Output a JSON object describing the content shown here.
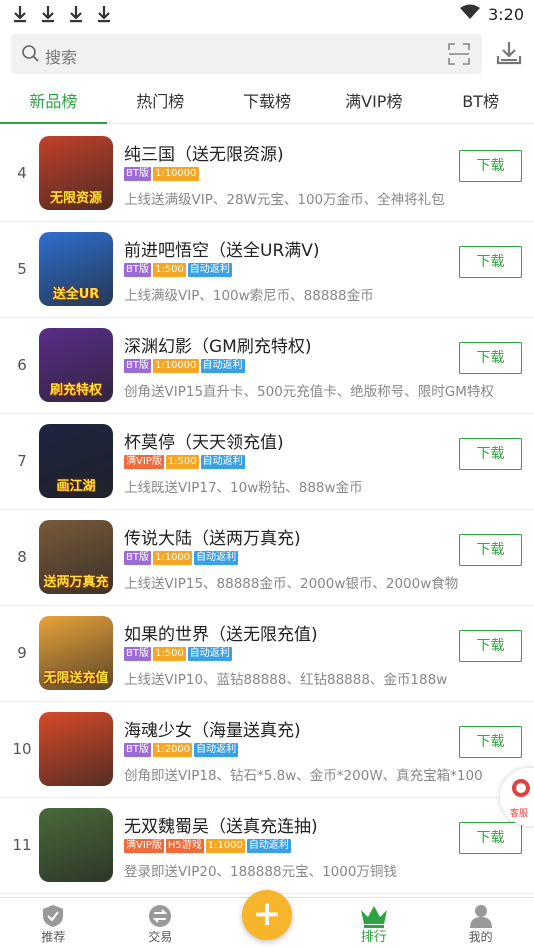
{
  "status_bar": {
    "time": "3:20"
  },
  "search": {
    "placeholder": "搜索"
  },
  "tabs": [
    {
      "label": "新品榜",
      "active": true
    },
    {
      "label": "热门榜",
      "active": false
    },
    {
      "label": "下载榜",
      "active": false
    },
    {
      "label": "满VIP榜",
      "active": false
    },
    {
      "label": "BT榜",
      "active": false
    }
  ],
  "colors": {
    "accent": "#2ea344",
    "tag_bt": "#9b6cd6",
    "tag_ratio": "#f5a623",
    "tag_auto": "#3aa0e6",
    "tag_fullvip": "#f06a3a",
    "tag_h5": "#f06a3a",
    "fab": "#f7b52b"
  },
  "games": [
    {
      "rank": "4",
      "title": "纯三国（送无限资源)",
      "icon_text": "无限资源",
      "icon_bg": "#c2412a",
      "tags": [
        {
          "text": "BT版",
          "kind": "bt"
        },
        {
          "text": "1:10000",
          "kind": "ratio"
        }
      ],
      "desc": "上线送满级VIP、28W元宝、100万金币、全神将礼包",
      "button": "下载"
    },
    {
      "rank": "5",
      "title": "前进吧悟空（送全UR满V)",
      "icon_text": "送全UR",
      "icon_bg": "#2f6fd0",
      "tags": [
        {
          "text": "BT版",
          "kind": "bt"
        },
        {
          "text": "1:500",
          "kind": "ratio"
        },
        {
          "text": "自动返利",
          "kind": "auto"
        }
      ],
      "desc": "上线满级VIP、100w索尼币、88888金币",
      "button": "下载"
    },
    {
      "rank": "6",
      "title": "深渊幻影（GM刷充特权)",
      "icon_text": "刷充特权",
      "icon_bg": "#5a2d8a",
      "tags": [
        {
          "text": "BT版",
          "kind": "bt"
        },
        {
          "text": "1:10000",
          "kind": "ratio"
        },
        {
          "text": "自动返利",
          "kind": "auto"
        }
      ],
      "desc": "创角送VIP15直升卡、500元充值卡、绝版称号、限时GM特权",
      "button": "下载"
    },
    {
      "rank": "7",
      "title": "杯莫停（天天领充值)",
      "icon_text": "画江湖",
      "icon_bg": "#1c2440",
      "tags": [
        {
          "text": "满VIP版",
          "kind": "fullvip"
        },
        {
          "text": "1:500",
          "kind": "ratio"
        },
        {
          "text": "自动返利",
          "kind": "auto"
        }
      ],
      "desc": "上线既送VIP17、10w粉钻、888w金币",
      "button": "下载"
    },
    {
      "rank": "8",
      "title": "传说大陆（送两万真充)",
      "icon_text": "送两万真充",
      "icon_bg": "#7a5a3a",
      "tags": [
        {
          "text": "BT版",
          "kind": "bt"
        },
        {
          "text": "1:1000",
          "kind": "ratio"
        },
        {
          "text": "自动返利",
          "kind": "auto"
        }
      ],
      "desc": "上线送VIP15、88888金币、2000w银币、2000w食物",
      "button": "下载"
    },
    {
      "rank": "9",
      "title": "如果的世界（送无限充值)",
      "icon_text": "无限送充值",
      "icon_bg": "#e8a23a",
      "tags": [
        {
          "text": "BT版",
          "kind": "bt"
        },
        {
          "text": "1:500",
          "kind": "ratio"
        },
        {
          "text": "自动返利",
          "kind": "auto"
        }
      ],
      "desc": "上线送VIP10、蓝钻88888、红钻88888、金币188w",
      "button": "下载"
    },
    {
      "rank": "10",
      "title": "海魂少女（海量送真充)",
      "icon_text": "",
      "icon_bg": "#d84a2a",
      "tags": [
        {
          "text": "BT版",
          "kind": "bt"
        },
        {
          "text": "1:2000",
          "kind": "ratio"
        },
        {
          "text": "自动返利",
          "kind": "auto"
        }
      ],
      "desc": "创角即送VIP18、钻石*5.8w、金币*200W、真充宝箱*100",
      "button": "下载"
    },
    {
      "rank": "11",
      "title": "无双魏蜀吴（送真充连抽)",
      "icon_text": "",
      "icon_bg": "#4a6a3a",
      "tags": [
        {
          "text": "满VIP版",
          "kind": "fullvip"
        },
        {
          "text": "H5游戏",
          "kind": "h5"
        },
        {
          "text": "1:1000",
          "kind": "ratio"
        },
        {
          "text": "自动返利",
          "kind": "auto"
        }
      ],
      "desc": "登录即送VIP20、188888元宝、1000万铜钱",
      "button": "下载"
    }
  ],
  "float_service": {
    "label": "客服"
  },
  "bottom_nav": [
    {
      "label": "推荐",
      "icon": "shield-icon",
      "active": false
    },
    {
      "label": "交易",
      "icon": "exchange-icon",
      "active": false
    },
    {
      "label": "排行",
      "icon": "crown-icon",
      "active": true
    },
    {
      "label": "我的",
      "icon": "person-icon",
      "active": false
    }
  ],
  "fab": {
    "label": "+"
  }
}
